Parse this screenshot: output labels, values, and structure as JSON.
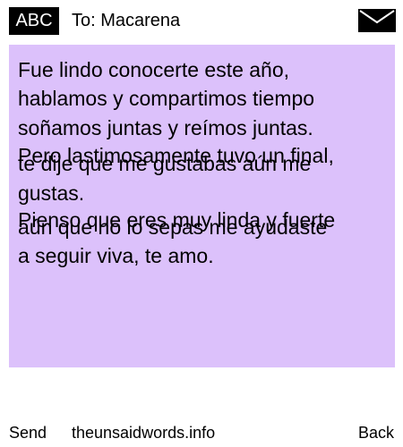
{
  "header": {
    "input_mode": "ABC",
    "recipient_line": "To: Macarena",
    "envelope_icon": "envelope-icon"
  },
  "message": {
    "background_color": "#dcc1fb",
    "lines": [
      "Fue lindo conocerte este año,",
      "hablamos y compartimos tiempo",
      "soñamos juntas y reímos juntas.",
      "Pero lastimosamente tuvo un final,",
      "te dije que me gustabas aún me",
      "gustas.",
      "Pienso que eres muy linda y fuerte",
      "aún que no lo sepas me ayudaste",
      "a seguir viva, te amo."
    ]
  },
  "footer": {
    "left_softkey": "Send",
    "site": "theunsaidwords.info",
    "right_softkey": "Back"
  }
}
